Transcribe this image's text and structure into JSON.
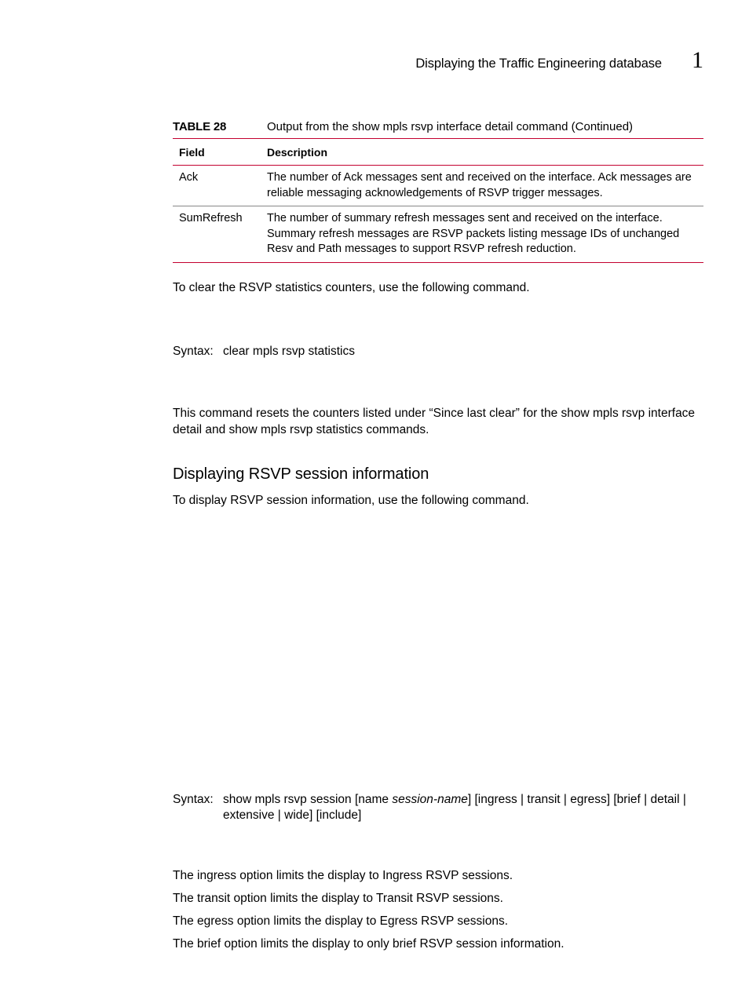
{
  "header": {
    "title": "Displaying the Traffic Engineering database",
    "chapter": "1"
  },
  "table": {
    "label": "TABLE 28",
    "title": "Output from the show mpls rsvp interface detail command  (Continued)",
    "head": {
      "field": "Field",
      "description": "Description"
    },
    "rows": [
      {
        "field": "Ack",
        "description": "The number of Ack messages sent and received on the interface. Ack messages are reliable messaging acknowledgements of RSVP trigger messages."
      },
      {
        "field": "SumRefresh",
        "description": "The number of summary refresh messages sent and received on the interface. Summary refresh messages are RSVP packets listing message IDs of unchanged Resv and Path messages to support RSVP refresh reduction."
      }
    ]
  },
  "body": {
    "clear_intro": "To clear the RSVP statistics counters, use the following command.",
    "syntax_label": "Syntax:",
    "syntax1": "clear mpls rsvp statistics",
    "clear_effect": "This command resets the counters listed under “Since last clear” for the show mpls rsvp interface detail and show mpls rsvp statistics commands.",
    "h3": "Displaying RSVP session information",
    "display_intro": "To display RSVP session information, use the following command.",
    "syntax2_pre": "show mpls rsvp session [name ",
    "syntax2_em": "session-name",
    "syntax2_post": "] [ingress | transit | egress] [brief | detail | extensive | wide] [include]",
    "opt_ingress": "The ingress option limits the display to Ingress RSVP sessions.",
    "opt_transit": "The transit option limits the display to Transit RSVP sessions.",
    "opt_egress": "The egress option limits the display to Egress RSVP sessions.",
    "opt_brief": "The brief option limits the display to only brief RSVP session information."
  }
}
